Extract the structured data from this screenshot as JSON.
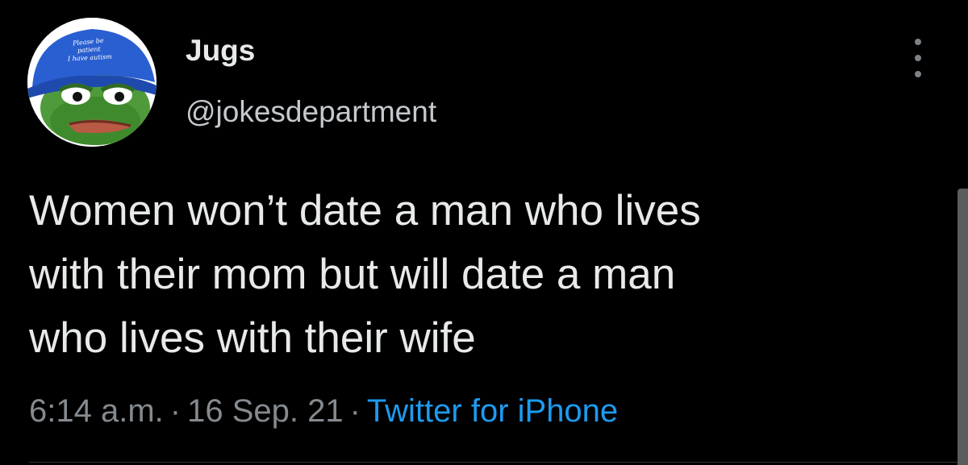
{
  "tweet": {
    "display_name": "Jugs",
    "username": "@jokesdepartment",
    "text_lines": [
      "Women won’t date a man who lives",
      "with their mom but will date a man",
      "who lives with their wife"
    ],
    "time": "6:14 a.m.",
    "separator": "·",
    "date": "16 Sep. 21",
    "source": "Twitter for iPhone"
  },
  "avatar": {
    "cap_text_lines": [
      "Please be",
      "patient",
      "I have autism"
    ],
    "icon": "pepe-frog-avatar"
  },
  "colors": {
    "background": "#000000",
    "text": "#e7e9ea",
    "muted": "#858a8f",
    "link": "#1d9bf0",
    "cap_blue": "#2a5fd1",
    "frog_green": "#4f9a3a"
  },
  "icons": {
    "more": "more-vertical-icon"
  }
}
